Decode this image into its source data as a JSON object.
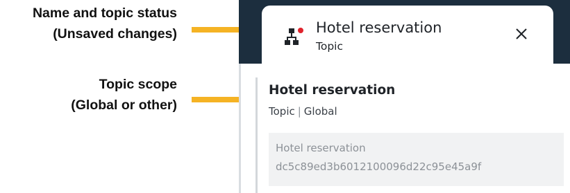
{
  "annotations": {
    "name_status": {
      "line1": "Name and topic status",
      "line2": "(Unsaved changes)"
    },
    "topic_scope": {
      "line1": "Topic scope",
      "line2": "(Global or other)"
    }
  },
  "tab": {
    "title": "Hotel reservation",
    "subtitle": "Topic",
    "icon": "topic-tree-icon",
    "status_indicator": "unsaved-changes-dot",
    "close_icon": "close-icon"
  },
  "details": {
    "title": "Hotel reservation",
    "type": "Topic",
    "scope": "Global",
    "separator": "|",
    "id_box": {
      "name": "Hotel reservation",
      "id": "dc5c89ed3b6012100096d22c95e45a9f"
    }
  },
  "colors": {
    "arrow": "#f5b324",
    "header_background": "#1c2e3e",
    "status_dot": "#e0232c"
  }
}
